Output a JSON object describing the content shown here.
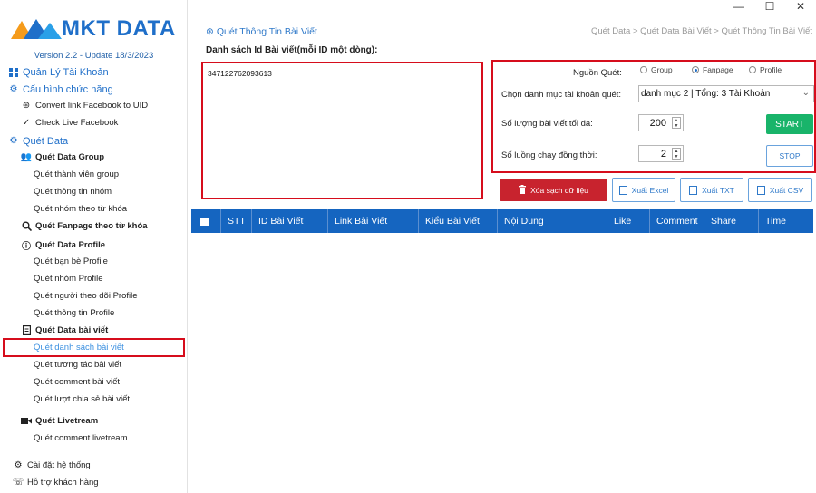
{
  "window": {
    "minimize": "—",
    "maximize": "☐",
    "close": "✕"
  },
  "logo": {
    "text": "MKT DATA"
  },
  "version": "Version 2.2 - Update 18/3/2023",
  "sidebar": {
    "account": "Quản Lý Tài Khoản",
    "config": "Cấu hình chức năng",
    "convert": "Convert link Facebook to UID",
    "checklive": "Check Live Facebook",
    "scan": "Quét Data",
    "group_head": "Quét Data Group",
    "group_items": [
      "Quét thành viên group",
      "Quét thông tin nhóm",
      "Quét nhóm theo từ khóa"
    ],
    "fanpage_head": "Quét Fanpage theo từ khóa",
    "profile_head": "Quét Data Profile",
    "profile_items": [
      "Quét bạn bè Profile",
      "Quét nhóm Profile",
      "Quét người theo dõi Profile",
      "Quét thông tin Profile"
    ],
    "post_head": "Quét Data bài viết",
    "post_items": [
      "Quét danh sách bài viết",
      "Quét tương tác bài viết",
      "Quét comment bài viết",
      "Quét lượt chia sẻ bài viết"
    ],
    "live_head": "Quét Livetream",
    "live_items": [
      "Quét comment livetream"
    ],
    "settings": "Cài đặt hệ thống",
    "support": "Hỗ trợ khách hàng"
  },
  "main": {
    "title": "Quét Thông Tin Bài Viết",
    "breadcrumb": "Quét Data > Quét Data Bài Viết > Quét Thông Tin Bài Viết",
    "list_label": "Danh sách Id Bài viết(mỗi ID một dòng):",
    "ids": "347122762093613"
  },
  "settings": {
    "source_label": "Nguồn Quét:",
    "source_options": [
      "Group",
      "Fanpage",
      "Profile"
    ],
    "source_selected": "Fanpage",
    "category_label": "Chọn danh mục tài khoản quét:",
    "category_value": "danh mục 2 | Tổng: 3 Tài Khoản",
    "max_posts_label": "Số lượng bài viết tối đa:",
    "max_posts": "200",
    "threads_label": "Số luồng chạy đồng thời:",
    "threads": "2",
    "start": "START",
    "stop": "STOP"
  },
  "actions": {
    "clear": "Xóa sạch dữ liệu",
    "excel": "Xuất Excel",
    "txt": "Xuất TXT",
    "csv": "Xuất CSV"
  },
  "table": {
    "columns": [
      "STT",
      "ID Bài Viết",
      "Link Bài Viết",
      "Kiểu Bài Viết",
      "Nội Dung",
      "Like",
      "Comment",
      "Share",
      "Time"
    ]
  },
  "colors": {
    "accent": "#1f6fc9",
    "header": "#1565c0",
    "start": "#19b46a",
    "clear": "#c8232e",
    "highlight": "#d60d1c"
  }
}
